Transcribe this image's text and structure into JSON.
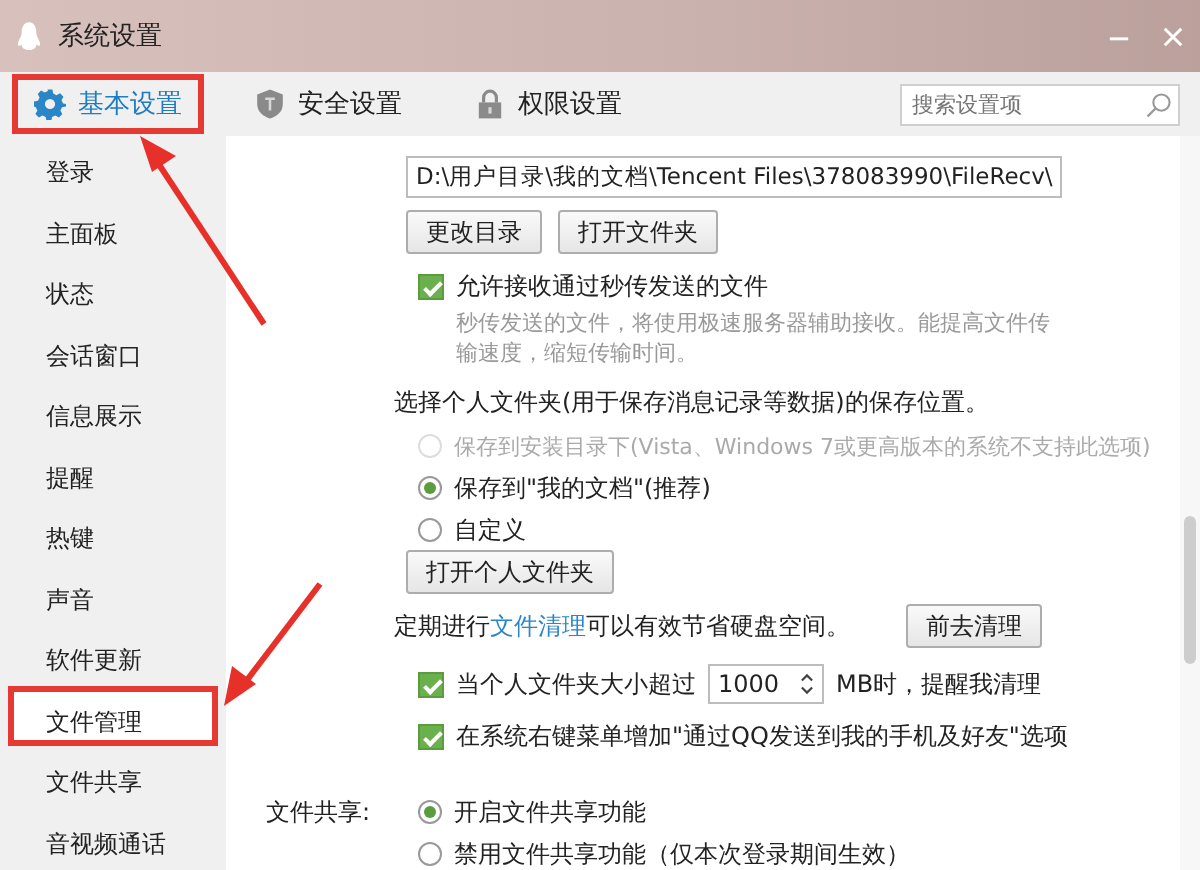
{
  "window": {
    "title": "系统设置"
  },
  "tabs": [
    {
      "label": "基本设置",
      "kind": "gear",
      "selected": true,
      "annotated": true
    },
    {
      "label": "安全设置",
      "kind": "shield",
      "selected": false,
      "annotated": false
    },
    {
      "label": "权限设置",
      "kind": "lock",
      "selected": false,
      "annotated": false
    }
  ],
  "search": {
    "placeholder": "搜索设置项"
  },
  "sidebar": {
    "items": [
      {
        "label": "登录",
        "selected": false,
        "annotated": false
      },
      {
        "label": "主面板",
        "selected": false,
        "annotated": false
      },
      {
        "label": "状态",
        "selected": false,
        "annotated": false
      },
      {
        "label": "会话窗口",
        "selected": false,
        "annotated": false
      },
      {
        "label": "信息展示",
        "selected": false,
        "annotated": false
      },
      {
        "label": "提醒",
        "selected": false,
        "annotated": false
      },
      {
        "label": "热键",
        "selected": false,
        "annotated": false
      },
      {
        "label": "声音",
        "selected": false,
        "annotated": false
      },
      {
        "label": "软件更新",
        "selected": false,
        "annotated": false
      },
      {
        "label": "文件管理",
        "selected": true,
        "annotated": true
      },
      {
        "label": "文件共享",
        "selected": false,
        "annotated": false
      },
      {
        "label": "音视频通话",
        "selected": false,
        "annotated": false
      }
    ]
  },
  "file_management": {
    "path": "D:\\用户目录\\我的文档\\Tencent Files\\378083990\\FileRecv\\",
    "buttons": [
      "更改目录",
      "打开文件夹"
    ],
    "fast_transfer": {
      "label": "允许接收通过秒传发送的文件",
      "checked": true,
      "hint": "秒传发送的文件，将使用极速服务器辅助接收。能提高文件传输速度，缩短传输时间。"
    },
    "folder_heading": "选择个人文件夹(用于保存消息记录等数据)的保存位置。",
    "location_options": [
      {
        "label": "保存到安装目录下(Vista、Windows 7或更高版本的系统不支持此选项)",
        "selected": false,
        "disabled": true
      },
      {
        "label": "保存到\"我的文档\"(推荐)",
        "selected": true,
        "disabled": false
      },
      {
        "label": "自定义",
        "selected": false,
        "disabled": false
      }
    ],
    "open_folder_button": "打开个人文件夹",
    "cleanup": {
      "before": "定期进行",
      "link": "文件清理",
      "after": "可以有效节省硬盘空间。",
      "button": "前去清理"
    },
    "size_limit": {
      "checked": true,
      "before": "当个人文件夹大小超过",
      "value": "1000",
      "after": "MB时，提醒我清理"
    },
    "context_menu": {
      "checked": true,
      "label": "在系统右键菜单增加\"通过QQ发送到我的手机及好友\"选项"
    }
  },
  "file_sharing": {
    "label": "文件共享:",
    "options": [
      {
        "label": "开启文件共享功能",
        "selected": true
      },
      {
        "label": "禁用文件共享功能（仅本次登录期间生效）",
        "selected": false
      }
    ]
  }
}
